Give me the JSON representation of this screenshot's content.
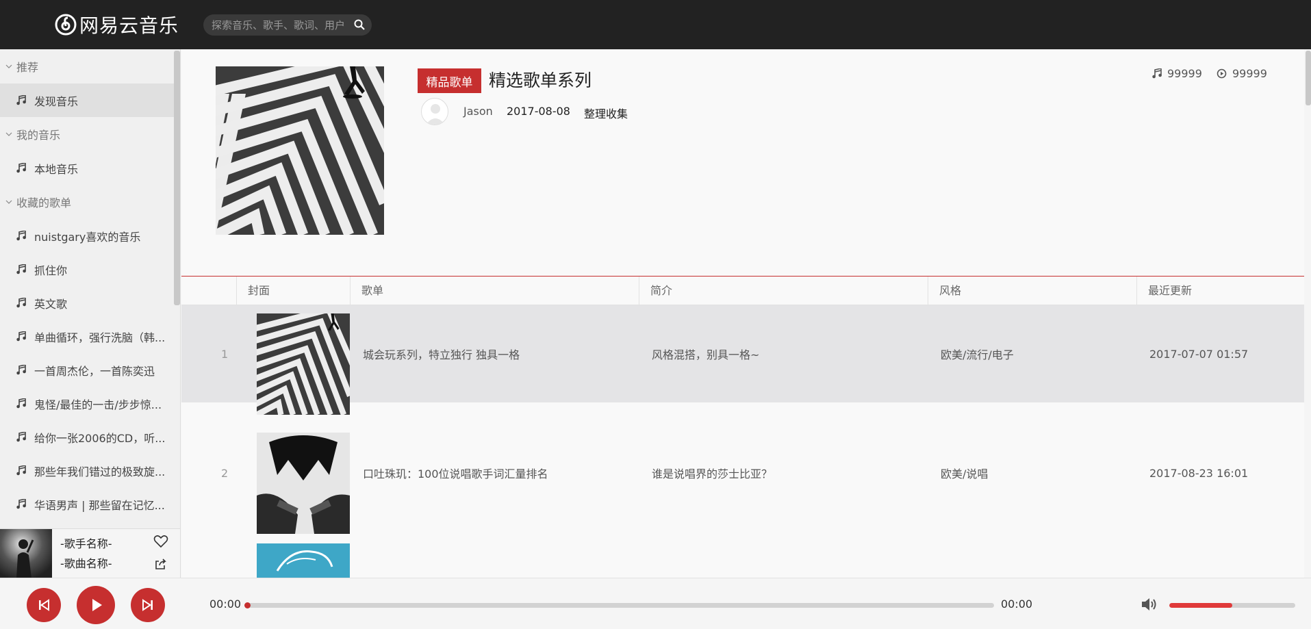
{
  "app": {
    "brand": "网易云音乐",
    "accent": "#c62f2f"
  },
  "search": {
    "placeholder": "探索音乐、歌手、歌词、用户"
  },
  "sidebar": {
    "groups": [
      {
        "label": "推荐",
        "items": [
          {
            "label": "发现音乐",
            "active": true
          }
        ]
      },
      {
        "label": "我的音乐",
        "items": [
          {
            "label": "本地音乐"
          }
        ]
      },
      {
        "label": "收藏的歌单",
        "items": [
          {
            "label": "nuistgary喜欢的音乐"
          },
          {
            "label": "抓住你"
          },
          {
            "label": "英文歌"
          },
          {
            "label": "单曲循环，强行洗脑（韩..."
          },
          {
            "label": "一首周杰伦，一首陈奕迅"
          },
          {
            "label": "鬼怪/最佳的一击/步步惊..."
          },
          {
            "label": "给你一张2006的CD，听..."
          },
          {
            "label": "那些年我们错过的极致旋..."
          },
          {
            "label": "华语男声 | 那些留在记忆..."
          }
        ]
      }
    ]
  },
  "now_playing": {
    "artist": "-歌手名称-",
    "song": "-歌曲名称-"
  },
  "playlist": {
    "tag": "精品歌单",
    "title": "精选歌单系列",
    "user": "Jason",
    "date": "2017-08-08",
    "action": "整理收集",
    "song_count": "99999",
    "play_count": "99999"
  },
  "table": {
    "headers": {
      "cover": "封面",
      "name": "歌单",
      "intro": "简介",
      "style": "风格",
      "updated": "最近更新"
    },
    "rows": [
      {
        "index": "1",
        "name": "城会玩系列，特立独行 独具一格",
        "intro": "风格混搭，别具一格~",
        "style": "欧美/流行/电子",
        "updated": "2017-07-07 01:57",
        "highlighted": true
      },
      {
        "index": "2",
        "name": "口吐珠玑：100位说唱歌手词汇量排名",
        "intro": "谁是说唱界的莎士比亚？",
        "style": "欧美/说唱",
        "updated": "2017-08-23 16:01",
        "highlighted": false
      },
      {
        "index": "",
        "name": "",
        "intro": "",
        "style": "",
        "updated": "",
        "highlighted": false
      }
    ]
  },
  "player": {
    "current_time": "00:00",
    "total_time": "00:00",
    "progress": 0,
    "volume": 0.5
  }
}
